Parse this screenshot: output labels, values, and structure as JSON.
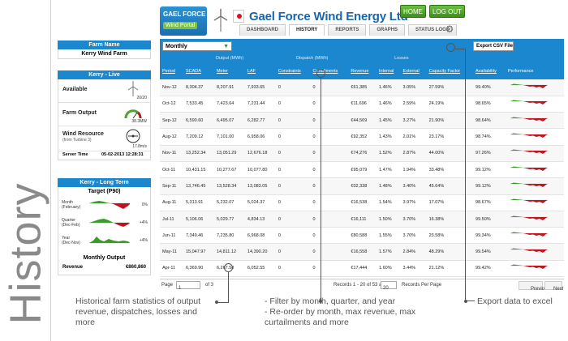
{
  "side_title": "History",
  "header": {
    "logo_line1": "GAEL FORCE",
    "logo_line2": "Wind Portal",
    "brand": "Gael Force Wind Energy Ltd",
    "home_label": "HOME",
    "logout_label": "LOG OUT",
    "tabs": [
      "DASHBOARD",
      "HISTORY",
      "REPORTS",
      "GRAPHS",
      "STATUS LOGS"
    ],
    "active_tab": "HISTORY"
  },
  "farm": {
    "header": "Farm Name",
    "name": "Kerry Wind Farm"
  },
  "live": {
    "header": "Kerry - Live",
    "available_label": "Available",
    "available_value": "20/20",
    "output_label": "Farm Output",
    "output_value": "38.3MW",
    "wind_label": "Wind Resource",
    "wind_sub": "(from Turbine 3)",
    "wind_value": "17.8m/s",
    "server_time_label": "Server Time",
    "server_time_value": "05-02-2013 12:28:31"
  },
  "long_term": {
    "header": "Kerry - Long Term",
    "target": "Target (P90)",
    "rows": [
      {
        "label": "Month",
        "sub": "(February)",
        "pct": "0%"
      },
      {
        "label": "Quarter",
        "sub": "(Dec-Feb)",
        "pct": "+4%"
      },
      {
        "label": "Year",
        "sub": "(Dec-Nov)",
        "pct": "+4%"
      }
    ],
    "monthly_output": "Monthly Output",
    "revenue_label": "Revenue",
    "revenue_value": "€860,860"
  },
  "toolbar": {
    "period_select": "Monthly",
    "export_label": "Export CSV File"
  },
  "table": {
    "groups": {
      "output": "Output (MWh)",
      "dispatch": "Dispatch (MWh)",
      "losses": "Losses"
    },
    "columns": [
      "Period",
      "SCADA",
      "Meter",
      "LAF",
      "Constraints",
      "Curtailments",
      "Revenue",
      "Internal",
      "External",
      "Capacity Factor",
      "Availability",
      "Performance"
    ],
    "rows": [
      [
        "Nov-12",
        "8,304.37",
        "8,207.91",
        "7,933.65",
        "0",
        "0",
        "€61,385",
        "1.46%",
        "3.05%",
        "27.59%",
        "99.40%"
      ],
      [
        "Oct-12",
        "7,533.45",
        "7,423.64",
        "7,231.44",
        "0",
        "0",
        "€11,696",
        "1.46%",
        "2.59%",
        "24.19%",
        "98.65%"
      ],
      [
        "Sep-12",
        "6,590.60",
        "6,495.07",
        "6,282.77",
        "0",
        "0",
        "€44,569",
        "1.45%",
        "3.27%",
        "21.90%",
        "98.64%"
      ],
      [
        "Aug-12",
        "7,209.12",
        "7,101.00",
        "6,958.06",
        "0",
        "0",
        "€92,352",
        "1.43%",
        "2.01%",
        "23.17%",
        "98.74%"
      ],
      [
        "Nov-11",
        "13,252.34",
        "13,051.29",
        "12,676.18",
        "0",
        "0",
        "€74,276",
        "1.52%",
        "2.87%",
        "44.00%",
        "97.26%"
      ],
      [
        "Oct-11",
        "10,431.15",
        "10,277.67",
        "10,077.80",
        "0",
        "0",
        "€95,079",
        "1.47%",
        "1.94%",
        "33.48%",
        "99.12%"
      ],
      [
        "Sep-11",
        "13,746.45",
        "13,528.34",
        "13,083.05",
        "0",
        "0",
        "€02,338",
        "1.48%",
        "3.40%",
        "45.64%",
        "99.12%"
      ],
      [
        "Aug-11",
        "5,313.91",
        "5,232.07",
        "5,024.37",
        "0",
        "0",
        "€16,538",
        "1.54%",
        "3.97%",
        "17.07%",
        "98.67%"
      ],
      [
        "Jul-11",
        "5,106.06",
        "5,029.77",
        "4,834.13",
        "0",
        "0",
        "€16,111",
        "1.50%",
        "3.70%",
        "16.38%",
        "99.50%"
      ],
      [
        "Jun-11",
        "7,349.46",
        "7,235.80",
        "6,968.08",
        "0",
        "0",
        "€80,588",
        "1.55%",
        "3.70%",
        "23.58%",
        "99.34%"
      ],
      [
        "May-11",
        "15,047.97",
        "14,811.12",
        "14,390.20",
        "0",
        "0",
        "€16,558",
        "1.57%",
        "2.84%",
        "48.29%",
        "99.54%"
      ],
      [
        "Apr-11",
        "6,369.90",
        "6,267.58",
        "6,052.55",
        "0",
        "0",
        "€17,444",
        "1.60%",
        "3.44%",
        "21.12%",
        "99.42%"
      ]
    ]
  },
  "pager": {
    "page_label": "Page",
    "page_value": "1",
    "of_label": "of 3",
    "records": "Records 1 - 20 of 53 at",
    "per_page_value": "20",
    "per_page_label": "Records Per Page",
    "prev_label": "Previous",
    "next_label": "Next"
  },
  "callouts": {
    "left": "Historical farm statistics of output revenue, dispatches, losses and more",
    "middle_1": "- Filter by month, quarter, and year",
    "middle_2": "- Re-order by month, max revenue, max curtailments and more",
    "right": "Export data to excel"
  },
  "colors": {
    "accent_blue": "#1b87cf",
    "brand_blue": "#1a66ad",
    "button_green": "#4fa52a",
    "loss_red": "#c0141c",
    "gain_green": "#3a9a2a"
  }
}
